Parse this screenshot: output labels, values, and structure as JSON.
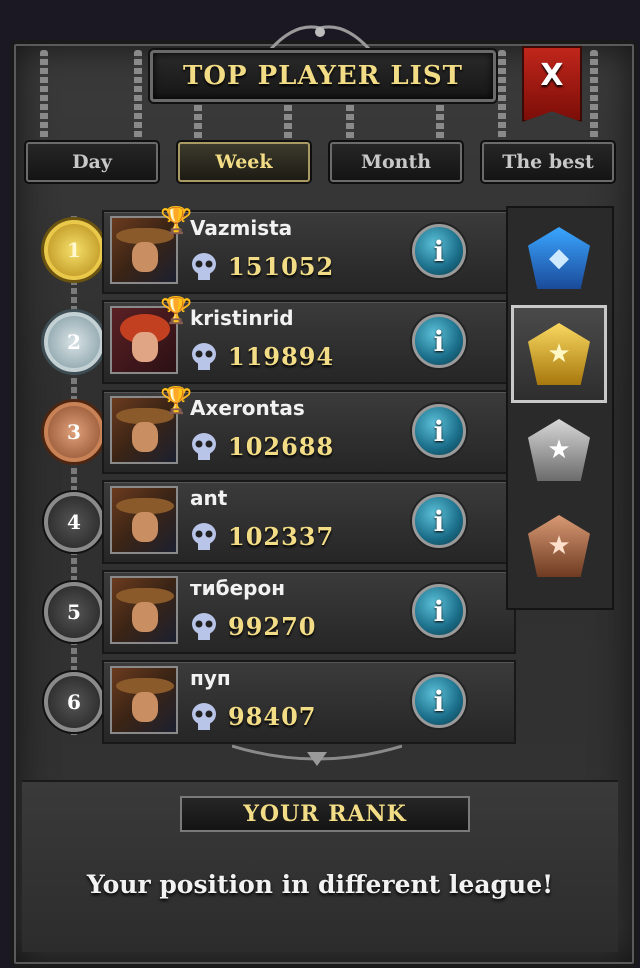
{
  "header": {
    "title": "TOP PLAYER LIST",
    "close_label": "X"
  },
  "tabs": [
    {
      "label": "Day",
      "active": false
    },
    {
      "label": "Week",
      "active": true
    },
    {
      "label": "Month",
      "active": false
    },
    {
      "label": "The best",
      "active": false
    }
  ],
  "players": [
    {
      "rank": "1",
      "name": "Vazmista",
      "score": "151052",
      "trophy": "gold-trophy",
      "badge": "gold",
      "avatar": "cowboy"
    },
    {
      "rank": "2",
      "name": "kristinrid",
      "score": "119894",
      "trophy": "silver-trophy",
      "badge": "silver",
      "avatar": "redhead"
    },
    {
      "rank": "3",
      "name": "Axerontas",
      "score": "102688",
      "trophy": "bronze-trophy",
      "badge": "bronze",
      "avatar": "cowboy"
    },
    {
      "rank": "4",
      "name": "ant",
      "score": "102337",
      "trophy": "",
      "badge": "plain",
      "avatar": "cowboy"
    },
    {
      "rank": "5",
      "name": "тиберон",
      "score": "99270",
      "trophy": "",
      "badge": "plain",
      "avatar": "cowboy"
    },
    {
      "rank": "6",
      "name": "пуп",
      "score": "98407",
      "trophy": "",
      "badge": "plain",
      "avatar": "cowboy"
    }
  ],
  "info_label": "i",
  "leagues": [
    {
      "icon": "diamond-league-emblem",
      "selected": false
    },
    {
      "icon": "gold-league-emblem",
      "selected": true
    },
    {
      "icon": "silver-league-emblem",
      "selected": false
    },
    {
      "icon": "bronze-league-emblem",
      "selected": false
    }
  ],
  "your_rank": {
    "title": "YOUR RANK",
    "message": "Your position in different league!"
  },
  "colors": {
    "gold_text": "#f3dc86",
    "close_red": "#c0261b",
    "info_blue": "#1a6d88"
  }
}
